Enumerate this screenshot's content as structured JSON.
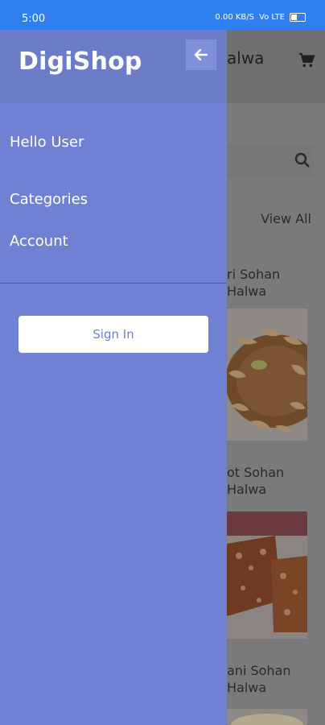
{
  "status_bar": {
    "time": "5:00",
    "network": "0.00 KB/S",
    "signal": "Vo LTE",
    "color": "#2f7ff0"
  },
  "drawer": {
    "app_name": "DigiShop",
    "greeting": "Hello User",
    "menu_items": [
      {
        "label": "Categories"
      },
      {
        "label": "Account"
      }
    ],
    "sign_in_label": "Sign In",
    "color": "#7081d4",
    "back_icon": "arrow-left-icon"
  },
  "background": {
    "header_title": "alwa",
    "view_all": "View All",
    "products": [
      {
        "title": "ri Sohan\nHalwa"
      },
      {
        "title": "ot Sohan\nHalwa"
      },
      {
        "title": "ani Sohan\nHalwa"
      }
    ],
    "cart_icon": "cart-icon",
    "search_icon": "search-icon"
  }
}
